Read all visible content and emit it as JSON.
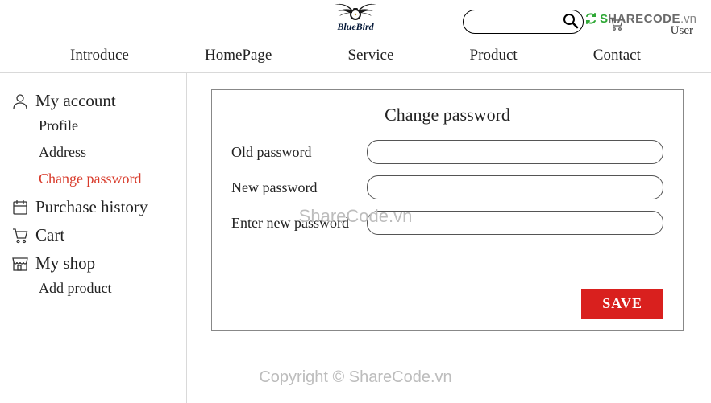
{
  "header": {
    "logo_text": "BlueBird",
    "user_label": "User",
    "search_placeholder": ""
  },
  "brand_right": {
    "part1": "S",
    "part2": "HARECODE",
    "part3": ".vn"
  },
  "nav": {
    "introduce": "Introduce",
    "homepage": "HomePage",
    "service": "Service",
    "product": "Product",
    "contact": "Contact"
  },
  "sidebar": {
    "account": {
      "title": "My account",
      "profile": "Profile",
      "address": "Address",
      "change_password": "Change password"
    },
    "purchase_history": "Purchase history",
    "cart": "Cart",
    "my_shop": "My shop",
    "add_product": "Add product"
  },
  "panel": {
    "title": "Change password",
    "old_label": "Old password",
    "new_label": "New password",
    "confirm_label": "Enter new password",
    "save": "SAVE"
  },
  "watermarks": {
    "w1": "ShareCode.vn",
    "w2": "Copyright © ShareCode.vn"
  }
}
